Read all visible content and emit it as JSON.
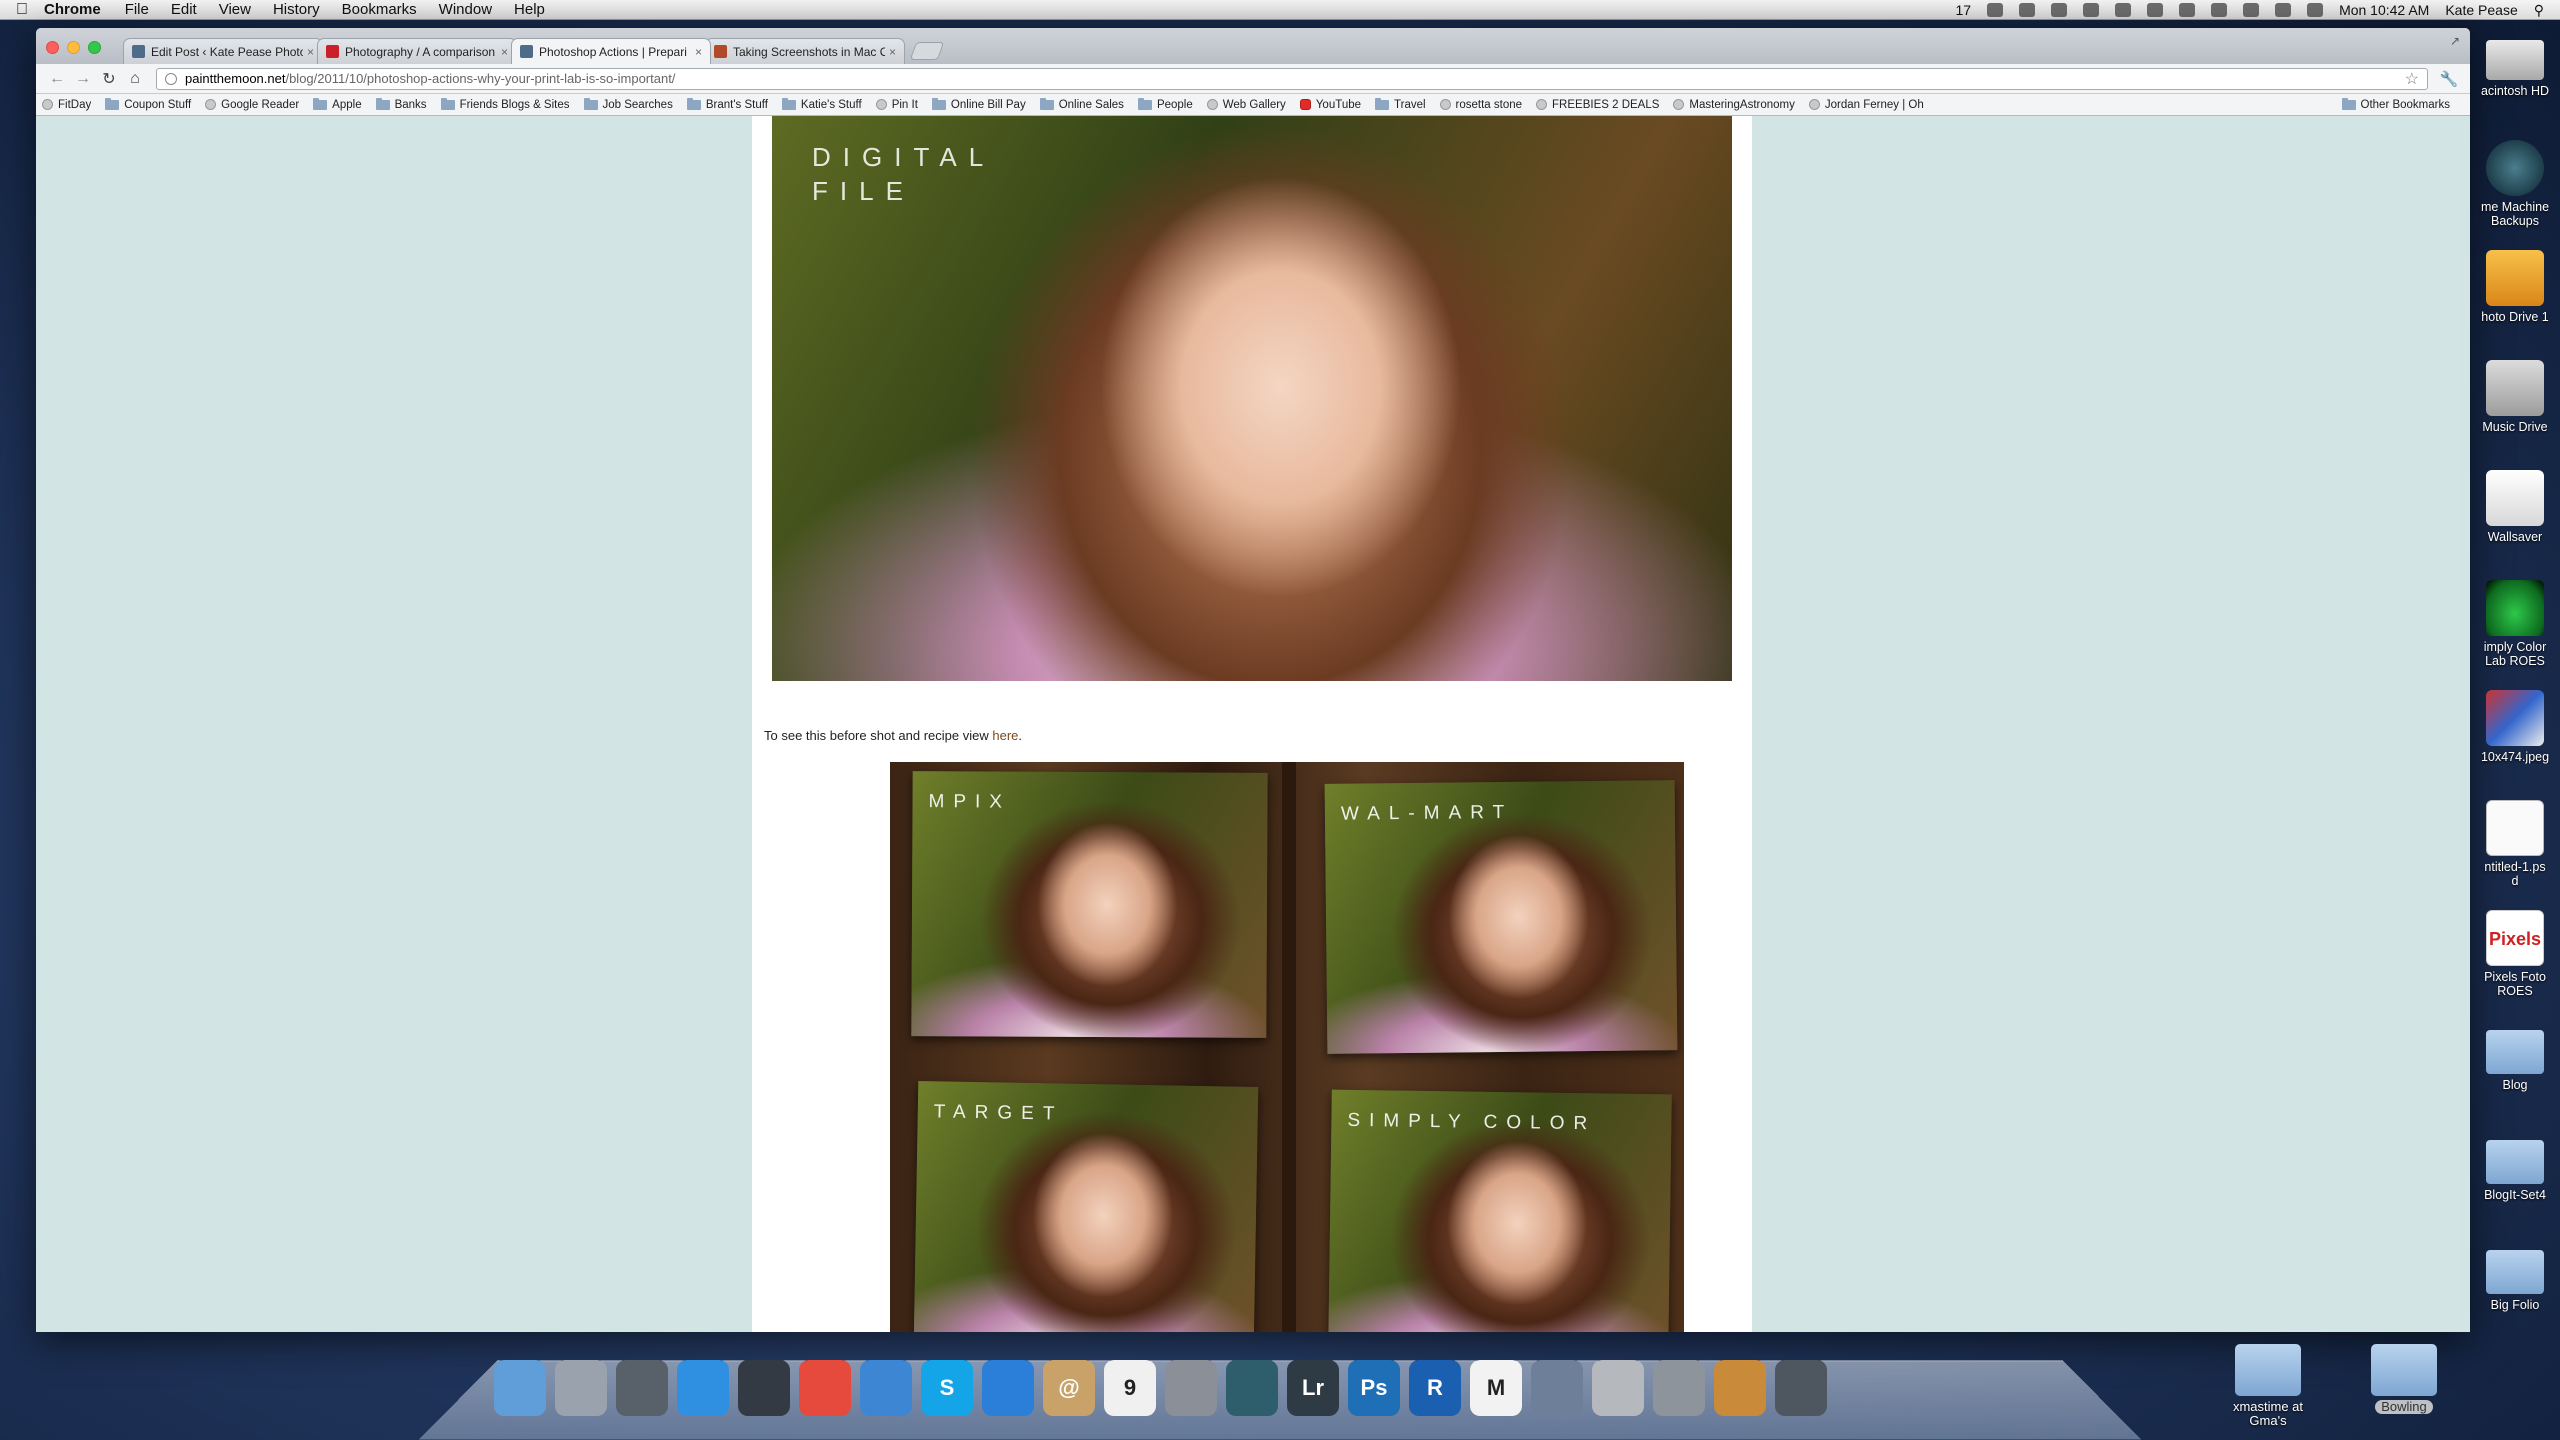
{
  "menubar": {
    "app_name": "Chrome",
    "menus": [
      "File",
      "Edit",
      "View",
      "History",
      "Bookmarks",
      "Window",
      "Help"
    ],
    "status_badge": "17",
    "clock": "Mon 10:42 AM",
    "user": "Kate Pease"
  },
  "browser": {
    "tabs": [
      {
        "label": "Edit Post ‹ Kate Pease Photog",
        "favicon_color": "#4f6b8a"
      },
      {
        "label": "Photography / A comparison",
        "favicon_color": "#cb2027"
      },
      {
        "label": "Photoshop Actions | Prepari",
        "favicon_color": "#4f6b8a"
      },
      {
        "label": "Taking Screenshots in Mac O",
        "favicon_color": "#b04a28"
      }
    ],
    "active_tab": 2,
    "url_domain": "paintthemoon.net",
    "url_path": "/blog/2011/10/photoshop-actions-why-your-print-lab-is-so-important/",
    "bookmarks": [
      {
        "label": "FitDay",
        "type": "site"
      },
      {
        "label": "Coupon Stuff",
        "type": "folder"
      },
      {
        "label": "Google Reader",
        "type": "site"
      },
      {
        "label": "Apple",
        "type": "folder"
      },
      {
        "label": "Banks",
        "type": "folder"
      },
      {
        "label": "Friends Blogs & Sites",
        "type": "folder"
      },
      {
        "label": "Job Searches",
        "type": "folder"
      },
      {
        "label": "Brant's Stuff",
        "type": "folder"
      },
      {
        "label": "Katie's Stuff",
        "type": "folder"
      },
      {
        "label": "Pin It",
        "type": "site"
      },
      {
        "label": "Online Bill Pay",
        "type": "folder"
      },
      {
        "label": "Online Sales",
        "type": "folder"
      },
      {
        "label": "People",
        "type": "folder"
      },
      {
        "label": "Web Gallery",
        "type": "site"
      },
      {
        "label": "YouTube",
        "type": "youtube"
      },
      {
        "label": "Travel",
        "type": "folder"
      },
      {
        "label": "rosetta stone",
        "type": "site"
      },
      {
        "label": "FREEBIES 2 DEALS",
        "type": "site"
      },
      {
        "label": "MasteringAstronomy",
        "type": "site"
      },
      {
        "label": "Jordan Ferney | Oh",
        "type": "site"
      }
    ],
    "other_bookmarks": "Other Bookmarks"
  },
  "post": {
    "hero_overlay": "DIGITAL\nFILE",
    "caption_text": "To see this before shot and recipe view ",
    "caption_link": "here",
    "caption_end": ".",
    "comparison": {
      "mpix": "MPIX",
      "walmart": "WAL-MART",
      "target": "TARGET",
      "simply_color": "SIMPLY COLOR"
    }
  },
  "desktop_icons": [
    {
      "label": "acintosh HD",
      "kind": "drive"
    },
    {
      "label": "me Machine\nBackups",
      "kind": "tm"
    },
    {
      "label": "hoto Drive 1",
      "kind": "usb"
    },
    {
      "label": "Music Drive",
      "kind": "music"
    },
    {
      "label": "Wallsaver",
      "kind": "white"
    },
    {
      "label": "imply Color\nLab ROES",
      "kind": "green"
    },
    {
      "label": "10x474.jpeg",
      "kind": "jpeg"
    },
    {
      "label": "ntitled-1.ps\nd",
      "kind": "doc"
    },
    {
      "label": "Pixels Foto\nROES",
      "kind": "pixels"
    },
    {
      "label": "Blog",
      "kind": "folder"
    },
    {
      "label": "BlogIt-Set4",
      "kind": "folder"
    },
    {
      "label": "Big Folio",
      "kind": "folder"
    }
  ],
  "dock": {
    "apps": [
      {
        "name": "finder",
        "glyph": "",
        "color": "#5f9ed8"
      },
      {
        "name": "launchpad",
        "glyph": "",
        "color": "#9aa3ad"
      },
      {
        "name": "photo-booth",
        "glyph": "",
        "color": "#58606a"
      },
      {
        "name": "app-store",
        "glyph": "",
        "color": "#2f8fe0"
      },
      {
        "name": "dashboard",
        "glyph": "",
        "color": "#333a44"
      },
      {
        "name": "chrome",
        "glyph": "",
        "color": "#e54a3c"
      },
      {
        "name": "safari",
        "glyph": "",
        "color": "#3d86d4"
      },
      {
        "name": "skype",
        "glyph": "S",
        "color": "#14a5e8"
      },
      {
        "name": "itunes",
        "glyph": "",
        "color": "#2c7fd8"
      },
      {
        "name": "mail",
        "glyph": "@",
        "color": "#c9a26a"
      },
      {
        "name": "ical",
        "glyph": "9",
        "color": "#f0f0f0"
      },
      {
        "name": "system-preferences",
        "glyph": "",
        "color": "#8b9098"
      },
      {
        "name": "time-machine",
        "glyph": "",
        "color": "#2e5e6c"
      },
      {
        "name": "lightroom",
        "glyph": "Lr",
        "color": "#2f3b44"
      },
      {
        "name": "photoshop",
        "glyph": "Ps",
        "color": "#1e6fb5"
      },
      {
        "name": "roes",
        "glyph": "R",
        "color": "#1a5fb0"
      },
      {
        "name": "m-app",
        "glyph": "M",
        "color": "#f2f2f2"
      },
      {
        "name": "script-editor",
        "glyph": "",
        "color": "#6d7f99"
      },
      {
        "name": "calculator",
        "glyph": "",
        "color": "#b5b8bd"
      },
      {
        "name": "stamp-app",
        "glyph": "",
        "color": "#8e949b"
      },
      {
        "name": "iphoto",
        "glyph": "",
        "color": "#c98a3a"
      },
      {
        "name": "facetime",
        "glyph": "",
        "color": "#4e5660"
      }
    ],
    "stacks": [
      {
        "label": "xmastime at\nGma's",
        "pill": false
      },
      {
        "label": "Bowling",
        "pill": true
      }
    ]
  }
}
